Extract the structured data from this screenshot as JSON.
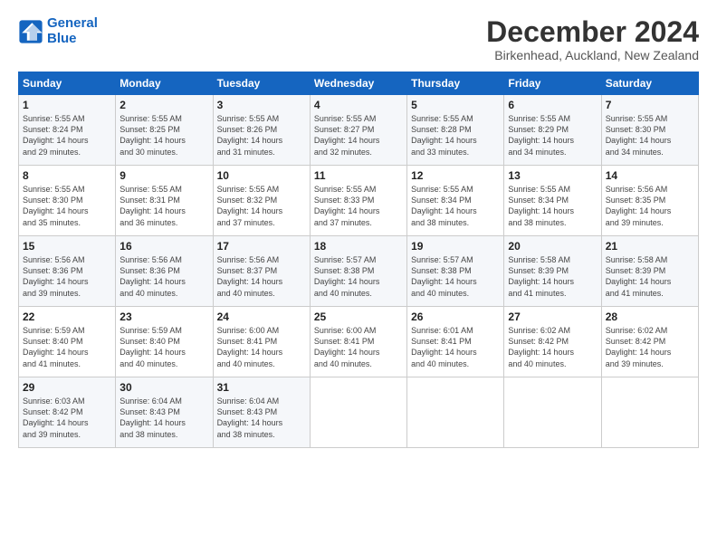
{
  "header": {
    "logo_line1": "General",
    "logo_line2": "Blue",
    "title": "December 2024",
    "location": "Birkenhead, Auckland, New Zealand"
  },
  "days_of_week": [
    "Sunday",
    "Monday",
    "Tuesday",
    "Wednesday",
    "Thursday",
    "Friday",
    "Saturday"
  ],
  "weeks": [
    [
      {
        "day": "1",
        "text": "Sunrise: 5:55 AM\nSunset: 8:24 PM\nDaylight: 14 hours\nand 29 minutes."
      },
      {
        "day": "2",
        "text": "Sunrise: 5:55 AM\nSunset: 8:25 PM\nDaylight: 14 hours\nand 30 minutes."
      },
      {
        "day": "3",
        "text": "Sunrise: 5:55 AM\nSunset: 8:26 PM\nDaylight: 14 hours\nand 31 minutes."
      },
      {
        "day": "4",
        "text": "Sunrise: 5:55 AM\nSunset: 8:27 PM\nDaylight: 14 hours\nand 32 minutes."
      },
      {
        "day": "5",
        "text": "Sunrise: 5:55 AM\nSunset: 8:28 PM\nDaylight: 14 hours\nand 33 minutes."
      },
      {
        "day": "6",
        "text": "Sunrise: 5:55 AM\nSunset: 8:29 PM\nDaylight: 14 hours\nand 34 minutes."
      },
      {
        "day": "7",
        "text": "Sunrise: 5:55 AM\nSunset: 8:30 PM\nDaylight: 14 hours\nand 34 minutes."
      }
    ],
    [
      {
        "day": "8",
        "text": "Sunrise: 5:55 AM\nSunset: 8:30 PM\nDaylight: 14 hours\nand 35 minutes."
      },
      {
        "day": "9",
        "text": "Sunrise: 5:55 AM\nSunset: 8:31 PM\nDaylight: 14 hours\nand 36 minutes."
      },
      {
        "day": "10",
        "text": "Sunrise: 5:55 AM\nSunset: 8:32 PM\nDaylight: 14 hours\nand 37 minutes."
      },
      {
        "day": "11",
        "text": "Sunrise: 5:55 AM\nSunset: 8:33 PM\nDaylight: 14 hours\nand 37 minutes."
      },
      {
        "day": "12",
        "text": "Sunrise: 5:55 AM\nSunset: 8:34 PM\nDaylight: 14 hours\nand 38 minutes."
      },
      {
        "day": "13",
        "text": "Sunrise: 5:55 AM\nSunset: 8:34 PM\nDaylight: 14 hours\nand 38 minutes."
      },
      {
        "day": "14",
        "text": "Sunrise: 5:56 AM\nSunset: 8:35 PM\nDaylight: 14 hours\nand 39 minutes."
      }
    ],
    [
      {
        "day": "15",
        "text": "Sunrise: 5:56 AM\nSunset: 8:36 PM\nDaylight: 14 hours\nand 39 minutes."
      },
      {
        "day": "16",
        "text": "Sunrise: 5:56 AM\nSunset: 8:36 PM\nDaylight: 14 hours\nand 40 minutes."
      },
      {
        "day": "17",
        "text": "Sunrise: 5:56 AM\nSunset: 8:37 PM\nDaylight: 14 hours\nand 40 minutes."
      },
      {
        "day": "18",
        "text": "Sunrise: 5:57 AM\nSunset: 8:38 PM\nDaylight: 14 hours\nand 40 minutes."
      },
      {
        "day": "19",
        "text": "Sunrise: 5:57 AM\nSunset: 8:38 PM\nDaylight: 14 hours\nand 40 minutes."
      },
      {
        "day": "20",
        "text": "Sunrise: 5:58 AM\nSunset: 8:39 PM\nDaylight: 14 hours\nand 41 minutes."
      },
      {
        "day": "21",
        "text": "Sunrise: 5:58 AM\nSunset: 8:39 PM\nDaylight: 14 hours\nand 41 minutes."
      }
    ],
    [
      {
        "day": "22",
        "text": "Sunrise: 5:59 AM\nSunset: 8:40 PM\nDaylight: 14 hours\nand 41 minutes."
      },
      {
        "day": "23",
        "text": "Sunrise: 5:59 AM\nSunset: 8:40 PM\nDaylight: 14 hours\nand 40 minutes."
      },
      {
        "day": "24",
        "text": "Sunrise: 6:00 AM\nSunset: 8:41 PM\nDaylight: 14 hours\nand 40 minutes."
      },
      {
        "day": "25",
        "text": "Sunrise: 6:00 AM\nSunset: 8:41 PM\nDaylight: 14 hours\nand 40 minutes."
      },
      {
        "day": "26",
        "text": "Sunrise: 6:01 AM\nSunset: 8:41 PM\nDaylight: 14 hours\nand 40 minutes."
      },
      {
        "day": "27",
        "text": "Sunrise: 6:02 AM\nSunset: 8:42 PM\nDaylight: 14 hours\nand 40 minutes."
      },
      {
        "day": "28",
        "text": "Sunrise: 6:02 AM\nSunset: 8:42 PM\nDaylight: 14 hours\nand 39 minutes."
      }
    ],
    [
      {
        "day": "29",
        "text": "Sunrise: 6:03 AM\nSunset: 8:42 PM\nDaylight: 14 hours\nand 39 minutes."
      },
      {
        "day": "30",
        "text": "Sunrise: 6:04 AM\nSunset: 8:43 PM\nDaylight: 14 hours\nand 38 minutes."
      },
      {
        "day": "31",
        "text": "Sunrise: 6:04 AM\nSunset: 8:43 PM\nDaylight: 14 hours\nand 38 minutes."
      },
      {
        "day": "",
        "text": ""
      },
      {
        "day": "",
        "text": ""
      },
      {
        "day": "",
        "text": ""
      },
      {
        "day": "",
        "text": ""
      }
    ]
  ]
}
